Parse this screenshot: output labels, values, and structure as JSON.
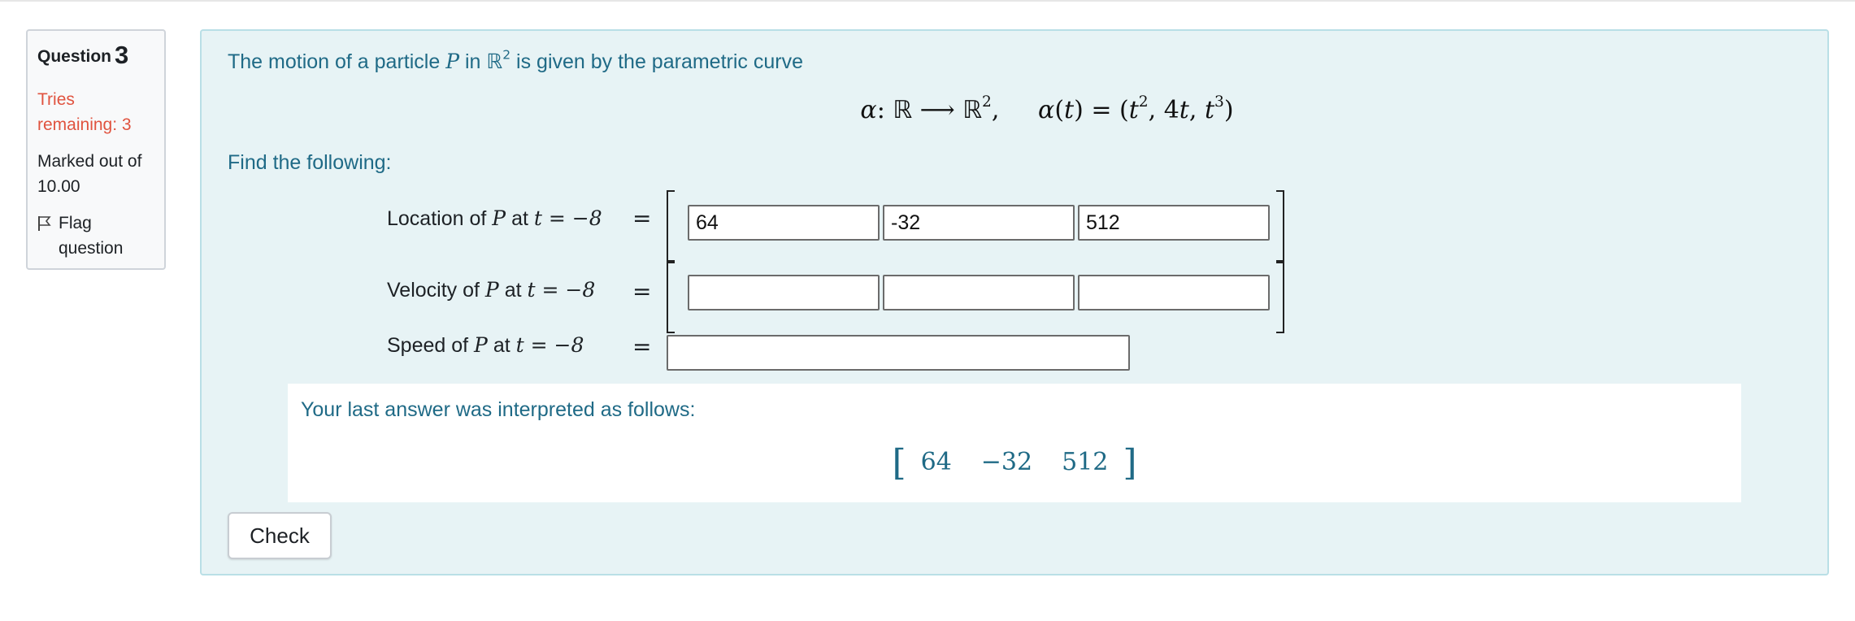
{
  "info": {
    "question_label": "Question",
    "question_number": "3",
    "tries": "Tries remaining: 3",
    "marked": "Marked out of 10.00",
    "flag_label": "Flag question",
    "flag_icon": "flag-icon",
    "tries_color": "#e0533f"
  },
  "question": {
    "intro_before_p": "The motion of a particle",
    "p_symbol": "P",
    "in_word": "in",
    "intro_after": "is given by the parametric curve",
    "display_map": "α: ℝ ⟶ ℝ",
    "display_def": "α(t) = (t², 4t, t³)",
    "find_text": "Find the following:"
  },
  "rows": {
    "location_label": "Location of",
    "velocity_label": "Velocity of",
    "speed_label": "Speed of",
    "at_word": "at",
    "t_value": "t = −8",
    "equals": "="
  },
  "location": {
    "x": "64",
    "y": "-32",
    "z": "512"
  },
  "velocity": {
    "x": "",
    "y": "",
    "z": ""
  },
  "speed": {
    "value": ""
  },
  "feedback": {
    "text": "Your last answer was interpreted as follows:",
    "values": [
      "64",
      "−32",
      "512"
    ]
  },
  "check_label": "Check",
  "colors": {
    "text_blue": "#1f6a86",
    "content_bg": "#e7f3f5",
    "content_border": "#b9dfe6"
  }
}
